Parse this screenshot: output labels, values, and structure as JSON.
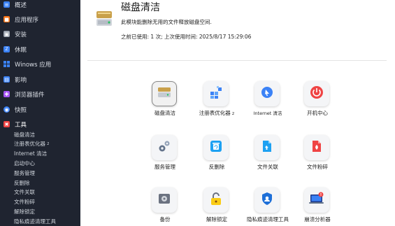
{
  "sidebar": {
    "items": [
      {
        "label": "概述",
        "icon": "overview-icon",
        "color": "#3b82f6"
      },
      {
        "label": "应用程序",
        "icon": "apps-icon",
        "color": "#f97316"
      },
      {
        "label": "安装",
        "icon": "install-icon",
        "color": "#9ca3af"
      },
      {
        "label": "休眠",
        "icon": "sleep-icon",
        "color": "#3b82f6"
      },
      {
        "label": "Winows 应用",
        "icon": "windows-icon",
        "color": "#3b82f6"
      },
      {
        "label": "影响",
        "icon": "impact-icon",
        "color": "#3b82f6"
      },
      {
        "label": "浏览器插件",
        "icon": "plugin-icon",
        "color": "#a855f7"
      },
      {
        "label": "快照",
        "icon": "snapshot-icon",
        "color": "#3b82f6"
      },
      {
        "label": "工具",
        "icon": "tools-icon",
        "color": "#ef4444"
      }
    ],
    "subitems": [
      {
        "label": "磁盘清洁",
        "suffix": ""
      },
      {
        "label": "注册表优化器",
        "suffix": "2"
      },
      {
        "label": "Internet 清洁",
        "suffix": ""
      },
      {
        "label": "启动中心",
        "suffix": ""
      },
      {
        "label": "服务管理",
        "suffix": ""
      },
      {
        "label": "反删除",
        "suffix": ""
      },
      {
        "label": "文件关联",
        "suffix": ""
      },
      {
        "label": "文件粉碎",
        "suffix": ""
      },
      {
        "label": "解除锁定",
        "suffix": ""
      },
      {
        "label": "隐私痕迹清理工具",
        "suffix": ""
      }
    ]
  },
  "header": {
    "title": "磁盘清洁",
    "description": "此模块能删除无用的文件释放磁盘空间.",
    "last_used": "之前已使用: 1 次; 上次使用时间: 2025/8/17 15:29:06"
  },
  "tools": [
    {
      "label": "磁盘清洁",
      "suffix": "",
      "icon": "disk-cleaner-icon",
      "selected": true
    },
    {
      "label": "注册表优化器",
      "suffix": "2",
      "icon": "registry-optimizer-icon"
    },
    {
      "label": "Internet 清洁",
      "suffix": "",
      "icon": "internet-cleaner-icon"
    },
    {
      "label": "开机中心",
      "suffix": "",
      "icon": "startup-center-icon"
    },
    {
      "label": "服务管理",
      "suffix": "",
      "icon": "service-manager-icon"
    },
    {
      "label": "反删除",
      "suffix": "",
      "icon": "undelete-icon"
    },
    {
      "label": "文件关联",
      "suffix": "",
      "icon": "file-association-icon"
    },
    {
      "label": "文件粉碎",
      "suffix": "",
      "icon": "file-shredder-icon"
    },
    {
      "label": "备份",
      "suffix": "",
      "icon": "backup-icon"
    },
    {
      "label": "解除锁定",
      "suffix": "",
      "icon": "unlock-icon"
    },
    {
      "label": "隐私痕迹清理工具",
      "suffix": "",
      "icon": "privacy-cleaner-icon"
    },
    {
      "label": "崩溃分析器",
      "suffix": "",
      "icon": "crash-analyzer-icon"
    }
  ],
  "colors": {
    "sidebar_bg": "#1f2430",
    "accent": "#ef4444"
  }
}
